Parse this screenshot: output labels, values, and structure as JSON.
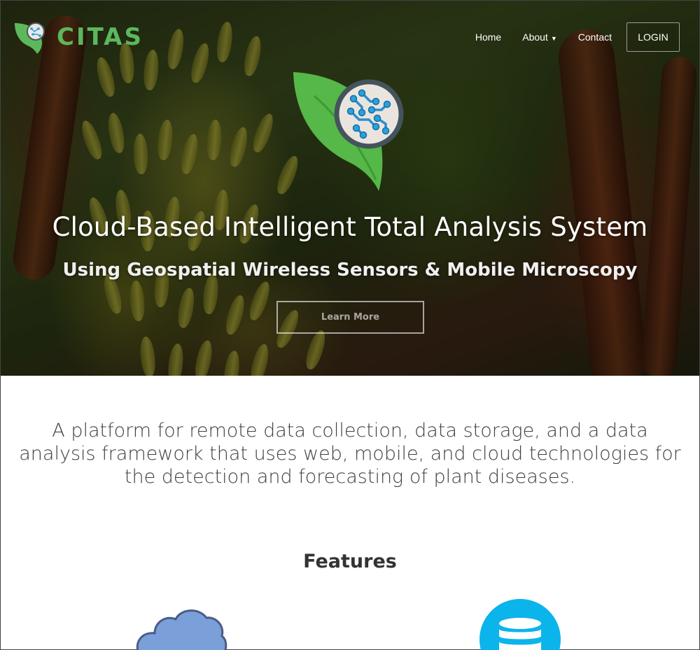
{
  "brand": {
    "name": "CITAS",
    "logo_icon": "leaf-circuit-icon",
    "color": "#5cb85c"
  },
  "nav": {
    "home": "Home",
    "about": "About",
    "contact": "Contact",
    "login": "LOGIN"
  },
  "hero": {
    "logo_icon": "leaf-circuit-icon",
    "title": "Cloud-Based Intelligent Total Analysis System",
    "subtitle": "Using Geospatial Wireless Sensors & Mobile Microscopy",
    "cta": "Learn More"
  },
  "intro": {
    "text": "A platform for remote data collection, data storage, and a data analysis framework that uses web, mobile, and cloud technologies for the detection and forecasting of plant diseases."
  },
  "features": {
    "heading": "Features",
    "items": [
      {
        "icon": "cloud-icon",
        "color": "#7b9fd9"
      },
      {
        "icon": "database-icon",
        "color": "#0cb4ec"
      }
    ]
  }
}
